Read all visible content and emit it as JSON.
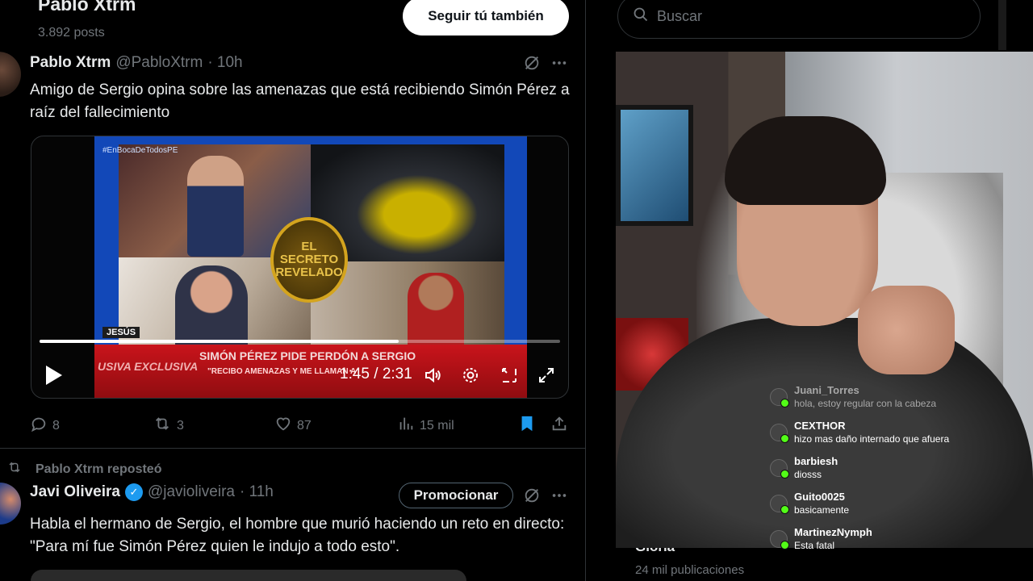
{
  "profile": {
    "name": "Pablo Xtrm",
    "posts": "3.892 posts",
    "follow_label": "Seguir tú también"
  },
  "tweet1": {
    "author": "Pablo Xtrm",
    "handle": "@PabloXtrm",
    "time": "· 10h",
    "text": "Amigo de Sergio opina sobre las amenazas que está recibiendo Simón Pérez a raíz del fallecimiento",
    "video": {
      "time": "1:45 / 2:31",
      "progress": 0.69,
      "hashtag": "#EnBocaDeTodosPE",
      "seal_text": "EL SECRETO REVELADO",
      "name_tag": "JESÚS",
      "headline": "SIMÓN PÉREZ PIDE PERDÓN A SERGIO",
      "subline": "\"RECIBO AMENAZAS Y ME LLAMAN A",
      "left_tag": "USIVA EXCLUSIVA"
    },
    "replies": "8",
    "reposts": "3",
    "likes": "87",
    "views": "15 mil"
  },
  "retweet_label": "Pablo Xtrm reposteó",
  "tweet2": {
    "author": "Javi Oliveira",
    "handle": "@javioliveira",
    "time": "· 11h",
    "promote_label": "Promocionar",
    "text": "Habla el hermano de Sergio, el hombre que murió haciendo un reto en directo: \"Para mí fue Simón Pérez quien le indujo a todo esto\"."
  },
  "sidebar": {
    "search_placeholder": "Buscar",
    "trend_name": "Gloria",
    "trend_count": "24 mil publicaciones"
  },
  "chat": [
    {
      "user": "Juani_Torres",
      "text": "hola, estoy regular con la cabeza",
      "faded": true
    },
    {
      "user": "CEXTHOR",
      "text": "hizo mas daño internado que afuera",
      "faded": false
    },
    {
      "user": "barbiesh",
      "text": "diosss",
      "faded": false
    },
    {
      "user": "Guito0025",
      "text": "basicamente",
      "faded": false
    },
    {
      "user": "MartinezNymph",
      "text": "Esta fatal",
      "faded": false
    }
  ],
  "colors": {
    "accent": "#1d9bf0",
    "bookmark": "#1d9bf0",
    "muted": "#71767b",
    "chat_badge": "#53fc18"
  }
}
